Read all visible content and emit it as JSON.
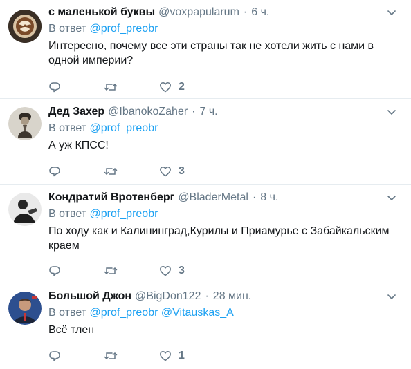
{
  "reply_prefix": "В ответ",
  "tweets": [
    {
      "display_name": "с маленькой буквы",
      "handle": "@voxpapularum",
      "separator": "·",
      "time": "6 ч.",
      "mentions": [
        "@prof_preobr"
      ],
      "text": "Интересно, почему все эти страны так не хотели жить с нами в одной империи?",
      "like_count": "2"
    },
    {
      "display_name": "Дед Захер",
      "handle": "@IbanokoZaher",
      "separator": "·",
      "time": "7 ч.",
      "mentions": [
        "@prof_preobr"
      ],
      "text": "А уж КПСС!",
      "like_count": "3"
    },
    {
      "display_name": "Кондратий Вротенберг",
      "handle": "@BladerMetal",
      "separator": "·",
      "time": "8 ч.",
      "mentions": [
        "@prof_preobr"
      ],
      "text": "По ходу как и Калининград,Курилы и Приамурье с Забайкальским краем",
      "like_count": "3"
    },
    {
      "display_name": "Большой Джон",
      "handle": "@BigDon122",
      "separator": "·",
      "time": "28 мин.",
      "mentions": [
        "@prof_preobr",
        "@Vitauskas_A"
      ],
      "text": "Всё тлен",
      "like_count": "1"
    }
  ],
  "colors": {
    "link": "#1da1f2",
    "secondary_text": "#657786",
    "primary_text": "#14171a",
    "divider": "#e6ecf0"
  },
  "icons": [
    "reply-icon",
    "retweet-icon",
    "heart-icon",
    "chevron-down-icon"
  ]
}
